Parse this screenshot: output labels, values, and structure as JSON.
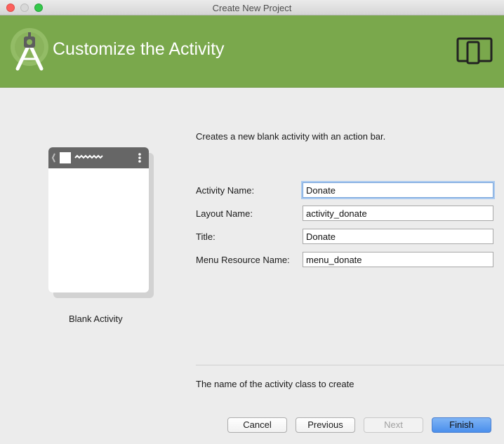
{
  "window": {
    "title": "Create New Project"
  },
  "header": {
    "title": "Customize the Activity",
    "logo_icon": "android-studio-logo-icon",
    "device_icon": "phone-tablet-icon",
    "background": "#7aa84c"
  },
  "preview": {
    "caption": "Blank Activity"
  },
  "description": "Creates a new blank activity with an action bar.",
  "fields": [
    {
      "label": "Activity Name:",
      "value": "Donate"
    },
    {
      "label": "Layout Name:",
      "value": "activity_donate"
    },
    {
      "label": "Title:",
      "value": "Donate"
    },
    {
      "label": "Menu Resource Name:",
      "value": "menu_donate"
    }
  ],
  "help_text": "The name of the activity class to create",
  "buttons": {
    "cancel": "Cancel",
    "previous": "Previous",
    "next": "Next",
    "finish": "Finish"
  },
  "colors": {
    "accent": "#4a8fec",
    "focus": "#a9c9ef"
  }
}
